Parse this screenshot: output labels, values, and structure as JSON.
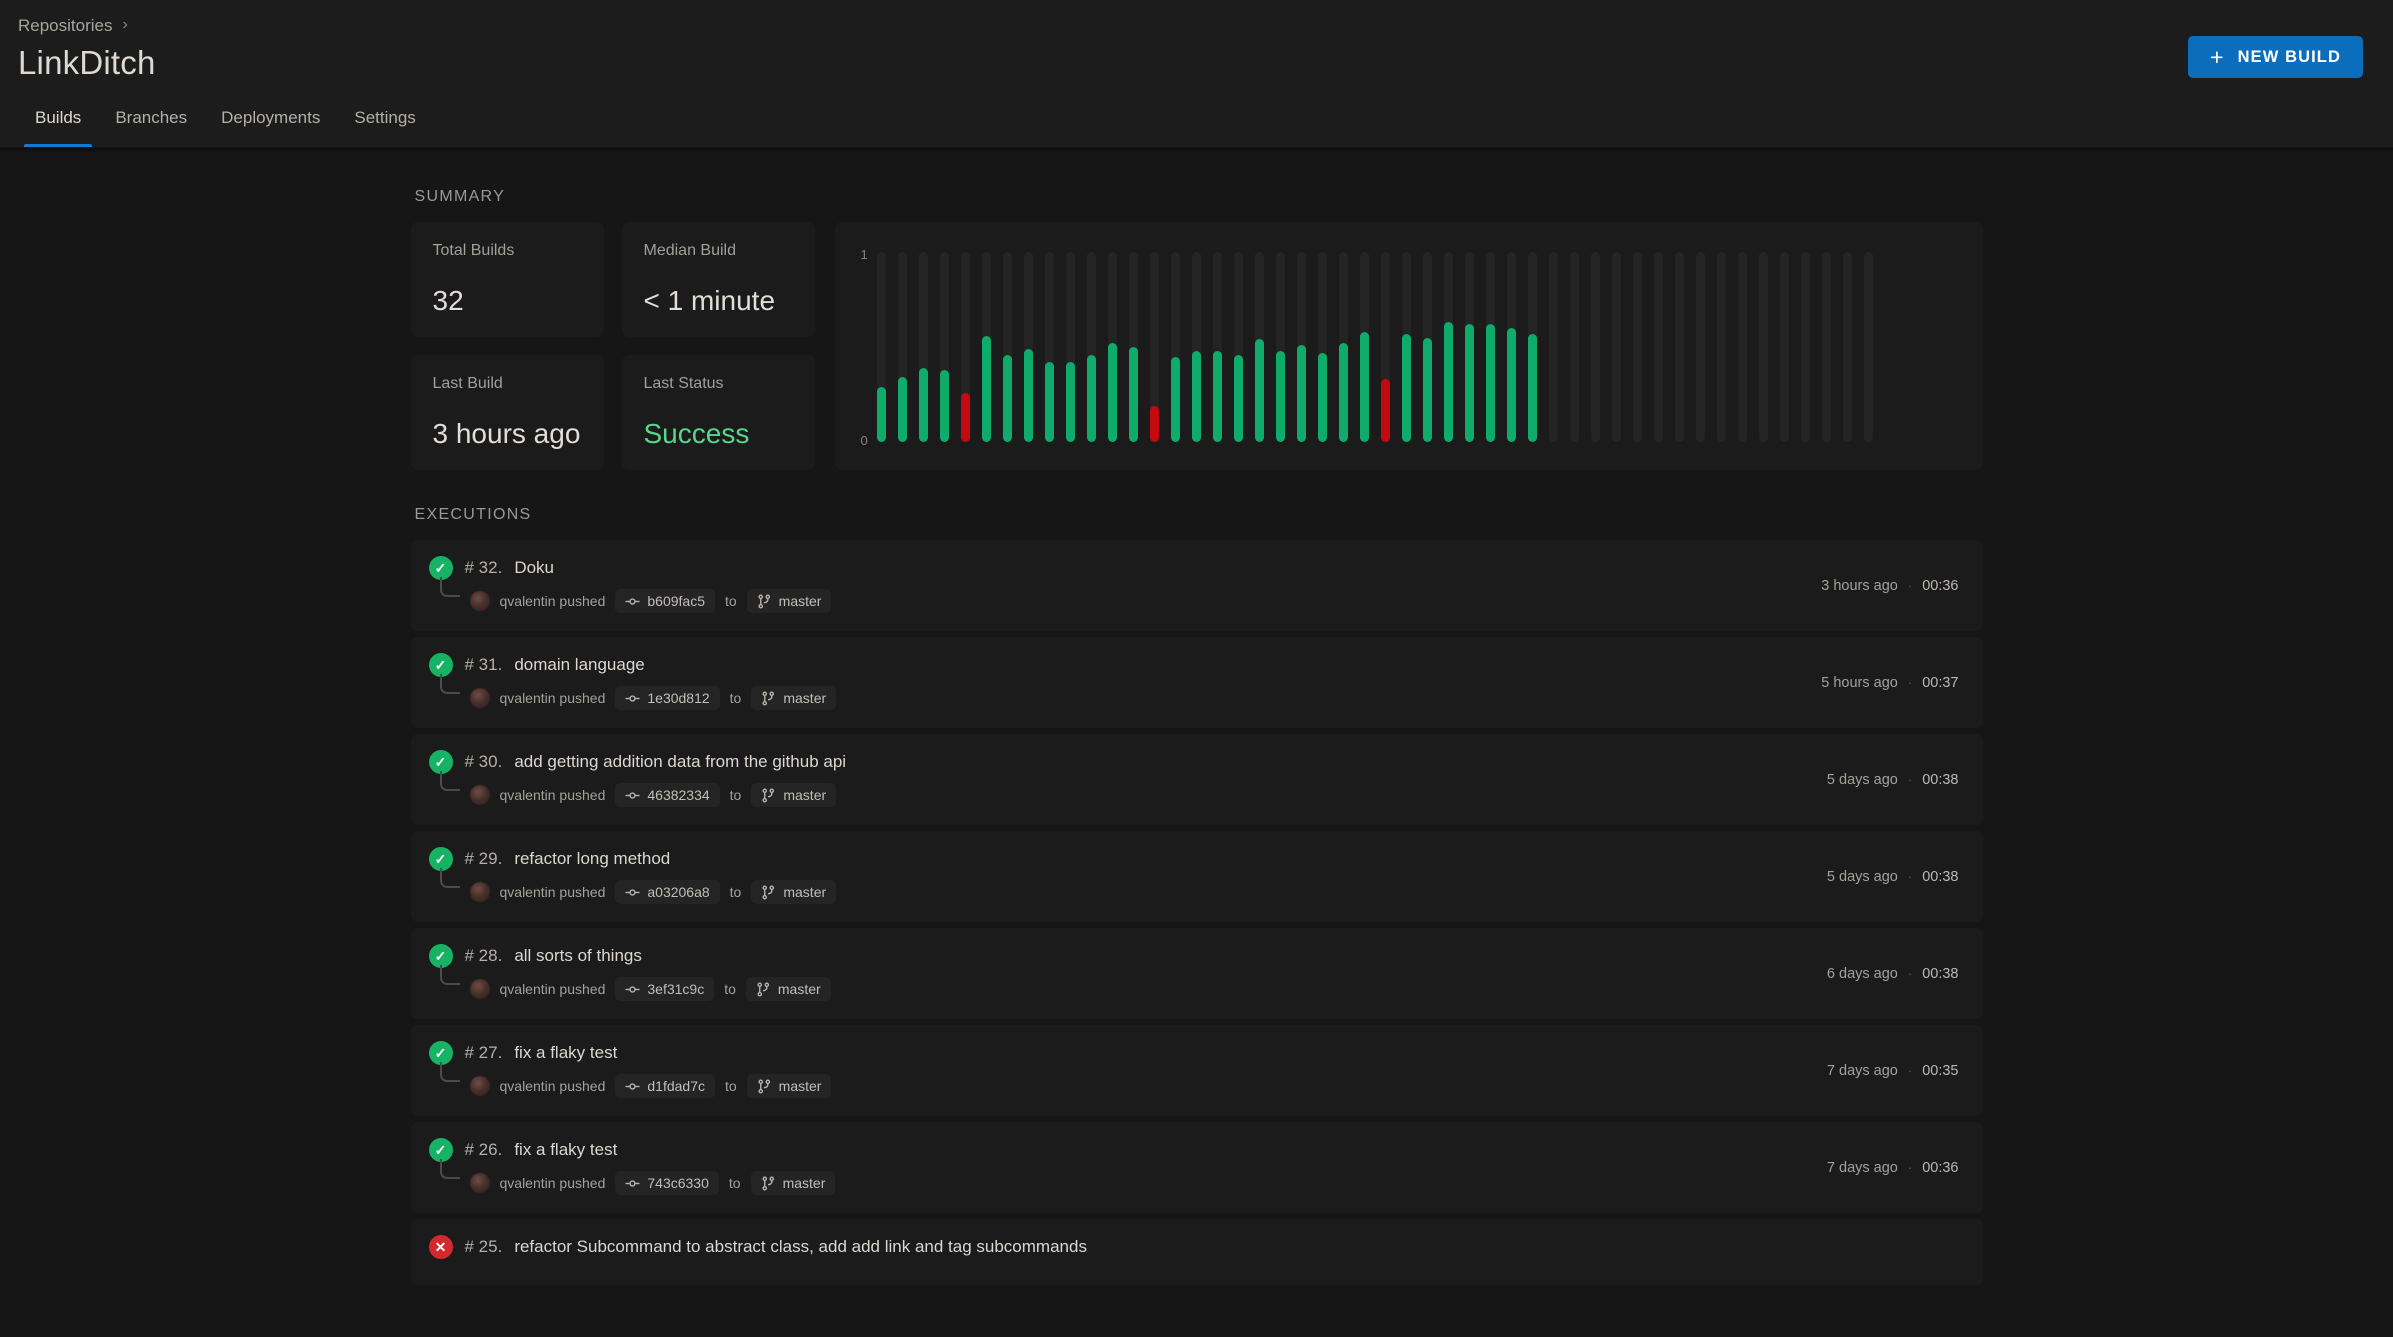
{
  "header": {
    "breadcrumb": {
      "label": "Repositories",
      "separator": "›",
      "separator_icon": "chevron-right-icon"
    },
    "title": "LinkDitch",
    "new_build_button": {
      "label": "NEW BUILD",
      "icon": "plus-icon",
      "color": "#0b6ebd"
    }
  },
  "tabs": [
    {
      "label": "Builds",
      "active": true
    },
    {
      "label": "Branches",
      "active": false
    },
    {
      "label": "Deployments",
      "active": false
    },
    {
      "label": "Settings",
      "active": false
    }
  ],
  "summary": {
    "section_label": "SUMMARY",
    "stats": [
      {
        "label": "Total Builds",
        "value": "32",
        "accent": false
      },
      {
        "label": "Median Build",
        "value": "< 1 minute",
        "accent": false
      },
      {
        "label": "Last Build",
        "value": "3 hours ago",
        "accent": false
      },
      {
        "label": "Last Status",
        "value": "Success",
        "accent": true,
        "color": "#58d68d"
      }
    ]
  },
  "chart_data": {
    "type": "bar",
    "title": "",
    "xlabel": "",
    "ylabel": "",
    "ylim": [
      0,
      1
    ],
    "ytick_labels": [
      "0",
      "1"
    ],
    "grid": false,
    "legend": null,
    "note": "Build duration per execution, normalized 0-1. Empty slots are unused track placeholders.",
    "colors": {
      "success": "#0eab6a",
      "failure": "#c40a10",
      "track": "#242424"
    },
    "total_slots": 48,
    "bars": [
      {
        "value": 0.29,
        "status": "success"
      },
      {
        "value": 0.34,
        "status": "success"
      },
      {
        "value": 0.39,
        "status": "success"
      },
      {
        "value": 0.38,
        "status": "success"
      },
      {
        "value": 0.26,
        "status": "failure"
      },
      {
        "value": 0.56,
        "status": "success"
      },
      {
        "value": 0.46,
        "status": "success"
      },
      {
        "value": 0.49,
        "status": "success"
      },
      {
        "value": 0.42,
        "status": "success"
      },
      {
        "value": 0.42,
        "status": "success"
      },
      {
        "value": 0.46,
        "status": "success"
      },
      {
        "value": 0.52,
        "status": "success"
      },
      {
        "value": 0.5,
        "status": "success"
      },
      {
        "value": 0.19,
        "status": "failure"
      },
      {
        "value": 0.45,
        "status": "success"
      },
      {
        "value": 0.48,
        "status": "success"
      },
      {
        "value": 0.48,
        "status": "success"
      },
      {
        "value": 0.46,
        "status": "success"
      },
      {
        "value": 0.54,
        "status": "success"
      },
      {
        "value": 0.48,
        "status": "success"
      },
      {
        "value": 0.51,
        "status": "success"
      },
      {
        "value": 0.47,
        "status": "success"
      },
      {
        "value": 0.52,
        "status": "success"
      },
      {
        "value": 0.58,
        "status": "success"
      },
      {
        "value": 0.33,
        "status": "failure"
      },
      {
        "value": 0.57,
        "status": "success"
      },
      {
        "value": 0.55,
        "status": "success"
      },
      {
        "value": 0.63,
        "status": "success"
      },
      {
        "value": 0.62,
        "status": "success"
      },
      {
        "value": 0.62,
        "status": "success"
      },
      {
        "value": 0.6,
        "status": "success"
      },
      {
        "value": 0.57,
        "status": "success"
      }
    ]
  },
  "executions": {
    "section_label": "EXECUTIONS",
    "to_label": "to",
    "pushed_label": "qvalentin pushed",
    "meta_separator": "·",
    "rows": [
      {
        "status": "success",
        "number": "# 32.",
        "title": "Doku",
        "author": "qvalentin pushed",
        "commit": "b609fac5",
        "branch": "master",
        "time": "3 hours ago",
        "duration": "00:36"
      },
      {
        "status": "success",
        "number": "# 31.",
        "title": "domain language",
        "author": "qvalentin pushed",
        "commit": "1e30d812",
        "branch": "master",
        "time": "5 hours ago",
        "duration": "00:37"
      },
      {
        "status": "success",
        "number": "# 30.",
        "title": "add getting addition data from the github api",
        "author": "qvalentin pushed",
        "commit": "46382334",
        "branch": "master",
        "time": "5 days ago",
        "duration": "00:38"
      },
      {
        "status": "success",
        "number": "# 29.",
        "title": "refactor long method",
        "author": "qvalentin pushed",
        "commit": "a03206a8",
        "branch": "master",
        "time": "5 days ago",
        "duration": "00:38"
      },
      {
        "status": "success",
        "number": "# 28.",
        "title": "all sorts of things",
        "author": "qvalentin pushed",
        "commit": "3ef31c9c",
        "branch": "master",
        "time": "6 days ago",
        "duration": "00:38"
      },
      {
        "status": "success",
        "number": "# 27.",
        "title": "fix a flaky test",
        "author": "qvalentin pushed",
        "commit": "d1fdad7c",
        "branch": "master",
        "time": "7 days ago",
        "duration": "00:35"
      },
      {
        "status": "success",
        "number": "# 26.",
        "title": "fix a flaky test",
        "author": "qvalentin pushed",
        "commit": "743c6330",
        "branch": "master",
        "time": "7 days ago",
        "duration": "00:36"
      },
      {
        "status": "failure",
        "number": "# 25.",
        "title": "refactor Subcommand to abstract class, add add link and tag subcommands",
        "author": "",
        "commit": "",
        "branch": "",
        "time": "",
        "duration": ""
      }
    ]
  },
  "icons": {
    "check": "✓",
    "cross": "✕",
    "commit": "git-commit-icon",
    "branch": "git-branch-icon"
  }
}
